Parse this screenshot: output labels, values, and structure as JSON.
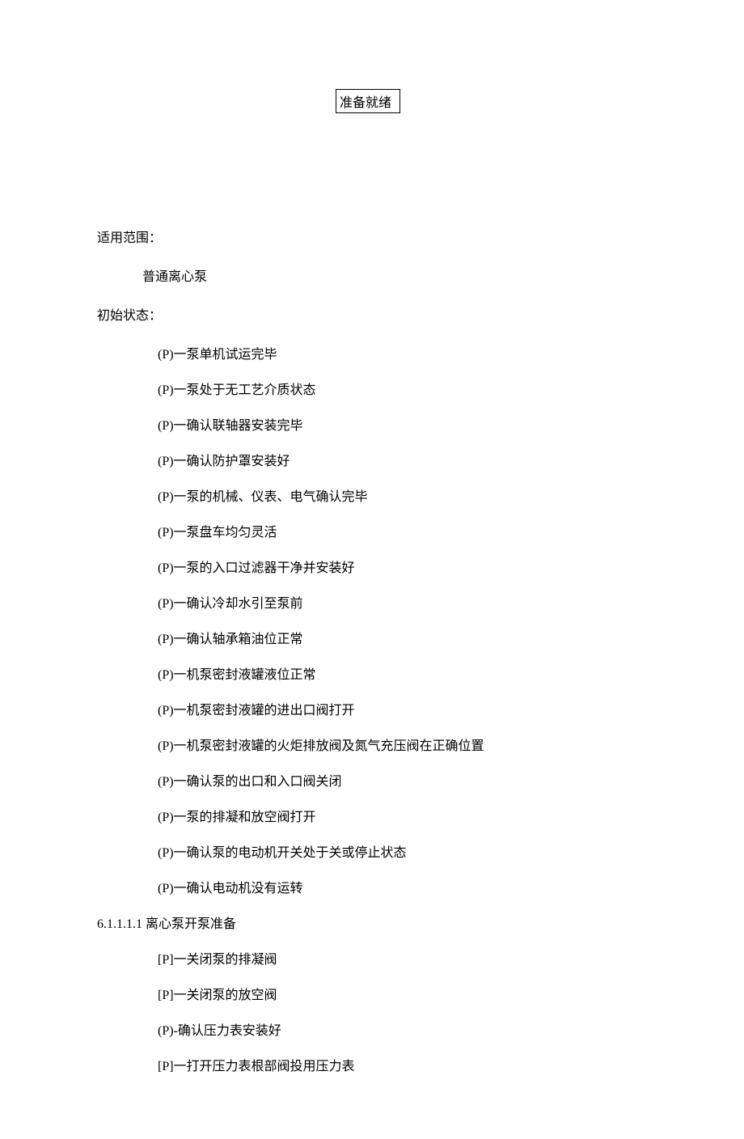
{
  "titleBox": "准备就绪",
  "scope": {
    "label": "适用范围：",
    "value": "普通离心泵"
  },
  "initialState": {
    "label": "初始状态：",
    "items": [
      "(P)一泵单机试运完毕",
      "(P)一泵处于无工艺介质状态",
      "(P)一确认联轴器安装完毕",
      "(P)一确认防护罩安装好",
      "(P)一泵的机械、仪表、电气确认完毕",
      "(P)一泵盘车均匀灵活",
      "(P)一泵的入口过滤器干净并安装好",
      "(P)一确认冷却水引至泵前",
      "(P)一确认轴承箱油位正常",
      "(P)一机泵密封液罐液位正常",
      "(P)一机泵密封液罐的进出口阀打开",
      "(P)一机泵密封液罐的火炬排放阀及氮气充压阀在正确位置",
      "(P)一确认泵的出口和入口阀关闭",
      "(P)一泵的排凝和放空阀打开",
      "(P)一确认泵的电动机开关处于关或停止状态",
      "(P)一确认电动机没有运转"
    ]
  },
  "prep": {
    "heading": "6.1.1.1.1 离心泵开泵准备",
    "items": [
      "[P]一关闭泵的排凝阀",
      "[P]一关闭泵的放空阀",
      "(P)-确认压力表安装好",
      "[P]一打开压力表根部阀投用压力表"
    ]
  }
}
